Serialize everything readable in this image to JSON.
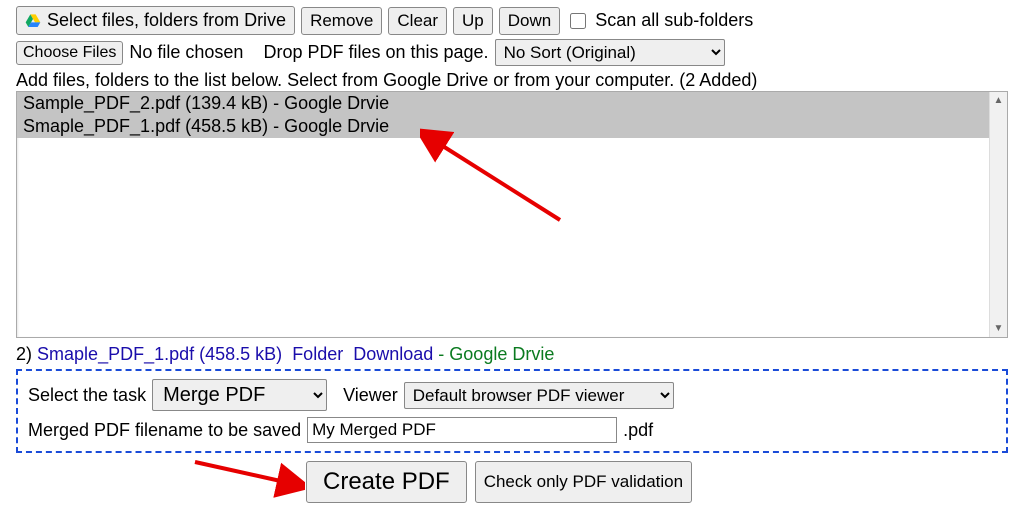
{
  "toolbar": {
    "drive_label": "Select files, folders from Drive",
    "remove": "Remove",
    "clear": "Clear",
    "up": "Up",
    "down": "Down",
    "scan_all": "Scan all sub-folders"
  },
  "row2": {
    "choose_files": "Choose Files",
    "no_file": "No file chosen",
    "drop_hint": "Drop PDF files on this page.",
    "sort_option": "No Sort (Original)"
  },
  "instruction": "Add files, folders to the list below. Select from Google Drive or from your computer. (2 Added)",
  "list_items": [
    "Sample_PDF_2.pdf (139.4 kB) - Google Drvie",
    "Smaple_PDF_1.pdf (458.5 kB) - Google Drvie"
  ],
  "selected": {
    "index": "2)",
    "name": "Smaple_PDF_1.pdf (458.5 kB)",
    "folder": "Folder",
    "download": "Download",
    "sep": " - ",
    "source": "Google Drvie"
  },
  "panel": {
    "task_label": "Select the task",
    "task_option": "Merge PDF",
    "viewer_label": "Viewer",
    "viewer_option": "Default browser PDF viewer",
    "filename_label": "Merged PDF filename to be saved",
    "filename_value": "My Merged PDF",
    "ext": ".pdf"
  },
  "actions": {
    "create": "Create PDF",
    "check": "Check only PDF validation"
  }
}
